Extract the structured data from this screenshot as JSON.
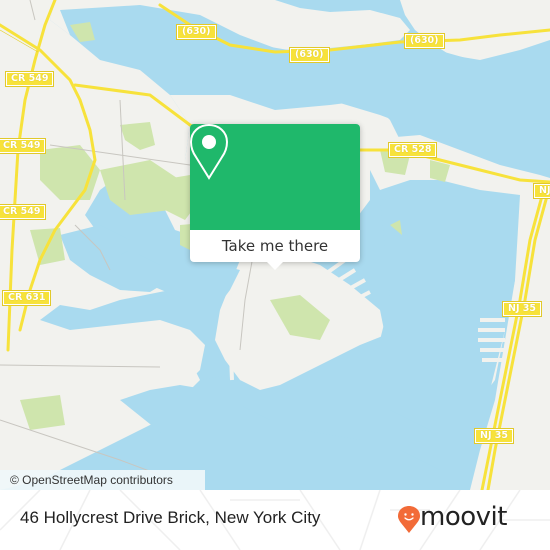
{
  "map": {
    "attribution": "© OpenStreetMap contributors",
    "colors": {
      "water": "#a9daef",
      "land": "#f2f2ee",
      "park": "#cfe5ad",
      "road_major": "#f7e23b",
      "road_minor": "#c8c6c0"
    },
    "road_labels": [
      {
        "id": "630-a",
        "text": "(630)"
      },
      {
        "id": "630-b",
        "text": "(630)"
      },
      {
        "id": "630-c",
        "text": "(630)"
      },
      {
        "id": "cr549-a",
        "text": "CR 549"
      },
      {
        "id": "cr549-b",
        "text": "CR 549"
      },
      {
        "id": "cr549-c",
        "text": "CR 549"
      },
      {
        "id": "cr631",
        "text": "CR 631"
      },
      {
        "id": "cr528",
        "text": "CR 528"
      },
      {
        "id": "nj35-a",
        "text": "NJ"
      },
      {
        "id": "nj35-b",
        "text": "NJ 35"
      },
      {
        "id": "nj35-c",
        "text": "NJ 35"
      }
    ]
  },
  "popup": {
    "icon": "map-pin-icon",
    "button_label": "Take me there",
    "color": "#1fb86b"
  },
  "footer": {
    "address": "46 Hollycrest Drive Brick, New York City",
    "brand": "moovit",
    "brand_icon": "moovit-pin-icon",
    "brand_color": "#f26b38"
  }
}
